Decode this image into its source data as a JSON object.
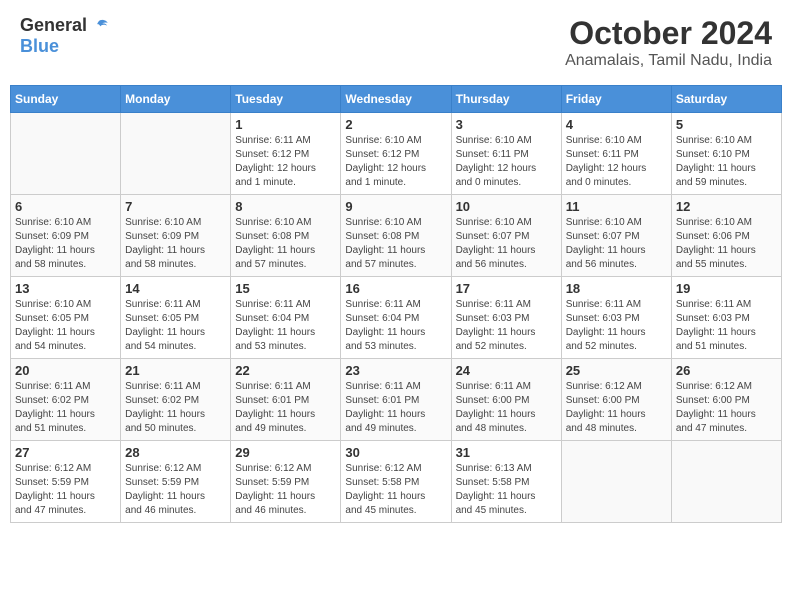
{
  "header": {
    "logo_general": "General",
    "logo_blue": "Blue",
    "month_title": "October 2024",
    "subtitle": "Anamalais, Tamil Nadu, India"
  },
  "days_of_week": [
    "Sunday",
    "Monday",
    "Tuesday",
    "Wednesday",
    "Thursday",
    "Friday",
    "Saturday"
  ],
  "weeks": [
    [
      {
        "day": "",
        "info": ""
      },
      {
        "day": "",
        "info": ""
      },
      {
        "day": "1",
        "info": "Sunrise: 6:11 AM\nSunset: 6:12 PM\nDaylight: 12 hours\nand 1 minute."
      },
      {
        "day": "2",
        "info": "Sunrise: 6:10 AM\nSunset: 6:12 PM\nDaylight: 12 hours\nand 1 minute."
      },
      {
        "day": "3",
        "info": "Sunrise: 6:10 AM\nSunset: 6:11 PM\nDaylight: 12 hours\nand 0 minutes."
      },
      {
        "day": "4",
        "info": "Sunrise: 6:10 AM\nSunset: 6:11 PM\nDaylight: 12 hours\nand 0 minutes."
      },
      {
        "day": "5",
        "info": "Sunrise: 6:10 AM\nSunset: 6:10 PM\nDaylight: 11 hours\nand 59 minutes."
      }
    ],
    [
      {
        "day": "6",
        "info": "Sunrise: 6:10 AM\nSunset: 6:09 PM\nDaylight: 11 hours\nand 58 minutes."
      },
      {
        "day": "7",
        "info": "Sunrise: 6:10 AM\nSunset: 6:09 PM\nDaylight: 11 hours\nand 58 minutes."
      },
      {
        "day": "8",
        "info": "Sunrise: 6:10 AM\nSunset: 6:08 PM\nDaylight: 11 hours\nand 57 minutes."
      },
      {
        "day": "9",
        "info": "Sunrise: 6:10 AM\nSunset: 6:08 PM\nDaylight: 11 hours\nand 57 minutes."
      },
      {
        "day": "10",
        "info": "Sunrise: 6:10 AM\nSunset: 6:07 PM\nDaylight: 11 hours\nand 56 minutes."
      },
      {
        "day": "11",
        "info": "Sunrise: 6:10 AM\nSunset: 6:07 PM\nDaylight: 11 hours\nand 56 minutes."
      },
      {
        "day": "12",
        "info": "Sunrise: 6:10 AM\nSunset: 6:06 PM\nDaylight: 11 hours\nand 55 minutes."
      }
    ],
    [
      {
        "day": "13",
        "info": "Sunrise: 6:10 AM\nSunset: 6:05 PM\nDaylight: 11 hours\nand 54 minutes."
      },
      {
        "day": "14",
        "info": "Sunrise: 6:11 AM\nSunset: 6:05 PM\nDaylight: 11 hours\nand 54 minutes."
      },
      {
        "day": "15",
        "info": "Sunrise: 6:11 AM\nSunset: 6:04 PM\nDaylight: 11 hours\nand 53 minutes."
      },
      {
        "day": "16",
        "info": "Sunrise: 6:11 AM\nSunset: 6:04 PM\nDaylight: 11 hours\nand 53 minutes."
      },
      {
        "day": "17",
        "info": "Sunrise: 6:11 AM\nSunset: 6:03 PM\nDaylight: 11 hours\nand 52 minutes."
      },
      {
        "day": "18",
        "info": "Sunrise: 6:11 AM\nSunset: 6:03 PM\nDaylight: 11 hours\nand 52 minutes."
      },
      {
        "day": "19",
        "info": "Sunrise: 6:11 AM\nSunset: 6:03 PM\nDaylight: 11 hours\nand 51 minutes."
      }
    ],
    [
      {
        "day": "20",
        "info": "Sunrise: 6:11 AM\nSunset: 6:02 PM\nDaylight: 11 hours\nand 51 minutes."
      },
      {
        "day": "21",
        "info": "Sunrise: 6:11 AM\nSunset: 6:02 PM\nDaylight: 11 hours\nand 50 minutes."
      },
      {
        "day": "22",
        "info": "Sunrise: 6:11 AM\nSunset: 6:01 PM\nDaylight: 11 hours\nand 49 minutes."
      },
      {
        "day": "23",
        "info": "Sunrise: 6:11 AM\nSunset: 6:01 PM\nDaylight: 11 hours\nand 49 minutes."
      },
      {
        "day": "24",
        "info": "Sunrise: 6:11 AM\nSunset: 6:00 PM\nDaylight: 11 hours\nand 48 minutes."
      },
      {
        "day": "25",
        "info": "Sunrise: 6:12 AM\nSunset: 6:00 PM\nDaylight: 11 hours\nand 48 minutes."
      },
      {
        "day": "26",
        "info": "Sunrise: 6:12 AM\nSunset: 6:00 PM\nDaylight: 11 hours\nand 47 minutes."
      }
    ],
    [
      {
        "day": "27",
        "info": "Sunrise: 6:12 AM\nSunset: 5:59 PM\nDaylight: 11 hours\nand 47 minutes."
      },
      {
        "day": "28",
        "info": "Sunrise: 6:12 AM\nSunset: 5:59 PM\nDaylight: 11 hours\nand 46 minutes."
      },
      {
        "day": "29",
        "info": "Sunrise: 6:12 AM\nSunset: 5:59 PM\nDaylight: 11 hours\nand 46 minutes."
      },
      {
        "day": "30",
        "info": "Sunrise: 6:12 AM\nSunset: 5:58 PM\nDaylight: 11 hours\nand 45 minutes."
      },
      {
        "day": "31",
        "info": "Sunrise: 6:13 AM\nSunset: 5:58 PM\nDaylight: 11 hours\nand 45 minutes."
      },
      {
        "day": "",
        "info": ""
      },
      {
        "day": "",
        "info": ""
      }
    ]
  ]
}
